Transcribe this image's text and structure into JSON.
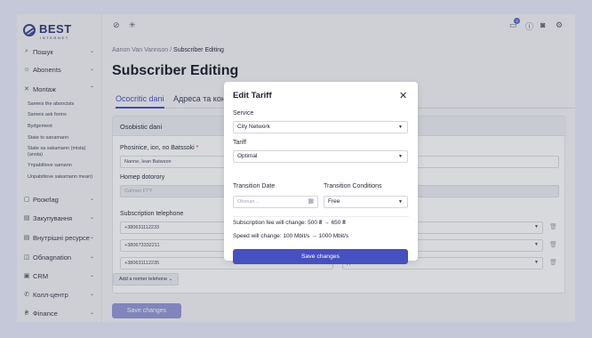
{
  "brand": {
    "name": "BEST",
    "subtitle": "INTERNET"
  },
  "sidebar": {
    "items": [
      {
        "icon": "search-icon",
        "glyph": "⌕",
        "label": "Пошук",
        "chev": "⌄"
      },
      {
        "icon": "users-icon",
        "glyph": "☺",
        "label": "Abonents",
        "chev": "⌄"
      },
      {
        "icon": "wrench-icon",
        "glyph": "✕",
        "label": "Montaж",
        "chev": "⌃"
      },
      {
        "icon": "box-icon",
        "glyph": "▢",
        "label": "Роокrlag",
        "chev": "⌄"
      },
      {
        "icon": "cart-icon",
        "glyph": "▤",
        "label": "Закупування",
        "chev": "⌄"
      },
      {
        "icon": "doc-icon",
        "glyph": "▤",
        "label": "Внутрішні ресурсе",
        "chev": "⌄"
      },
      {
        "icon": "equipment-icon",
        "glyph": "◫",
        "label": "Обnagnation",
        "chev": "⌄"
      },
      {
        "icon": "crm-icon",
        "glyph": "▣",
        "label": "CRM",
        "chev": "⌄"
      },
      {
        "icon": "phone-icon",
        "glyph": "✆",
        "label": "Колл-центр",
        "chev": "⌄"
      },
      {
        "icon": "finance-icon",
        "glyph": "₴",
        "label": "Фinance",
        "chev": "⌄"
      }
    ],
    "subitems": [
      "Sameis the aboncists",
      "Sameis ask forms",
      "Bydgement",
      "State to sanamann",
      "State sa sakamann (mista) (ansta)",
      "Ynpabiltove samann",
      "Unpabiltove sakamann mean)"
    ]
  },
  "topbar": {
    "left_icons": [
      "eye-off-icon",
      "sun-icon"
    ],
    "right_icons": [
      "inbox-icon",
      "help-icon",
      "bell-icon",
      "settings-icon"
    ],
    "notification_count": "2"
  },
  "breadcrumb": {
    "parent": "Aanon Van Vannson",
    "sep": "/",
    "current": "Subscriber Editing"
  },
  "page": {
    "title": "Subscriber Editing",
    "tabs": [
      "Осocritic dani",
      "Адреса та конт"
    ],
    "card_title": "Osobistic dani",
    "full_name_label": "Phosinice, ion, no Batssoki",
    "full_name_value": "Nanne, Iean Batwson",
    "home_label": "Homep dotorory",
    "home_value": "Cahnen FTY",
    "phones_label": "Subscription telephone",
    "phones": [
      "+380631112233",
      "+380673332211",
      "+380631112235"
    ],
    "phone_type_value": "Дпозоптомент",
    "add_phone_label": "Add a nomer telehone",
    "save_label": "Save changes"
  },
  "modal": {
    "title": "Edit Tariff",
    "close_glyph": "✕",
    "service_label": "Service",
    "service_value": "City Network",
    "tariff_label": "Tariff",
    "tariff_value": "Optimal",
    "date_label": "Transition Date",
    "date_placeholder": "Ohenan ...",
    "conditions_label": "Transition Conditions",
    "conditions_value": "Free",
    "fee_info": "Subscription fee will change: 500 ₴ → 650 ₴",
    "speed_info": "Speed will change: 100 Mbit/s → 1000 Mbit/s",
    "save_label": "Save changes"
  }
}
